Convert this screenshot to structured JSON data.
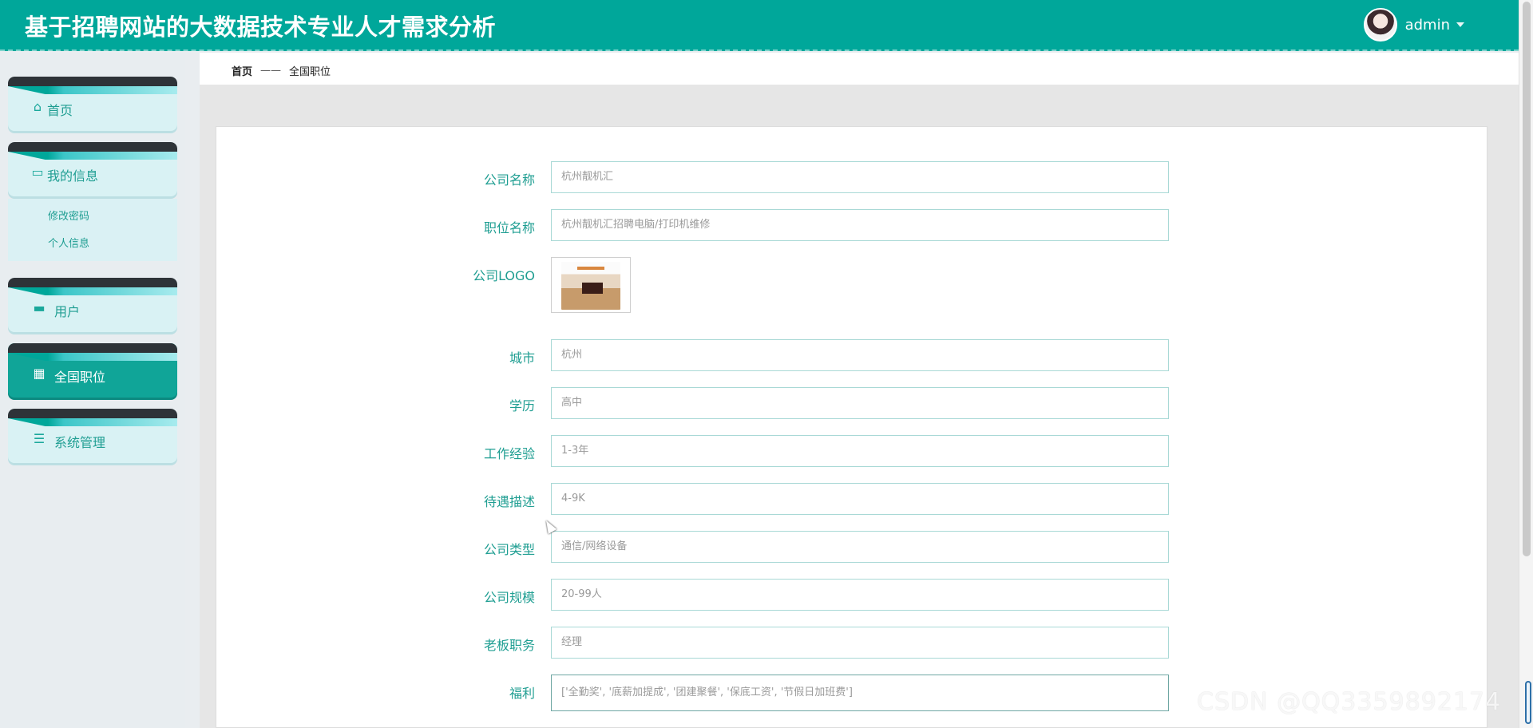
{
  "header": {
    "title": "基于招聘网站的大数据技术专业人才需求分析",
    "username": "admin"
  },
  "sidebar": {
    "items": [
      {
        "label": "首页",
        "icon": "home-icon"
      },
      {
        "label": "我的信息",
        "icon": "card-icon",
        "subitems": [
          "修改密码",
          "个人信息"
        ]
      },
      {
        "label": "用户",
        "icon": "monitor-icon"
      },
      {
        "label": "全国职位",
        "icon": "grid-icon",
        "active": true
      },
      {
        "label": "系统管理",
        "icon": "list-icon"
      }
    ]
  },
  "breadcrumb": {
    "home": "首页",
    "separator": "——",
    "current": "全国职位"
  },
  "form": {
    "company_name": {
      "label": "公司名称",
      "value": "杭州靓机汇"
    },
    "job_name": {
      "label": "职位名称",
      "value": "杭州靓机汇招聘电脑/打印机维修"
    },
    "company_logo": {
      "label": "公司LOGO"
    },
    "city": {
      "label": "城市",
      "value": "杭州"
    },
    "education": {
      "label": "学历",
      "value": "高中"
    },
    "experience": {
      "label": "工作经验",
      "value": "1-3年"
    },
    "salary": {
      "label": "待遇描述",
      "value": "4-9K"
    },
    "company_type": {
      "label": "公司类型",
      "value": "通信/网络设备"
    },
    "company_size": {
      "label": "公司规模",
      "value": "20-99人"
    },
    "boss_title": {
      "label": "老板职务",
      "value": "经理"
    },
    "welfare": {
      "label": "福利",
      "value": "['全勤奖', '底薪加提成', '团建聚餐', '保底工资', '节假日加班费']"
    }
  },
  "watermark": "CSDN @QQ3359892174",
  "colors": {
    "accent": "#00a79a",
    "label": "#1f9e92"
  }
}
